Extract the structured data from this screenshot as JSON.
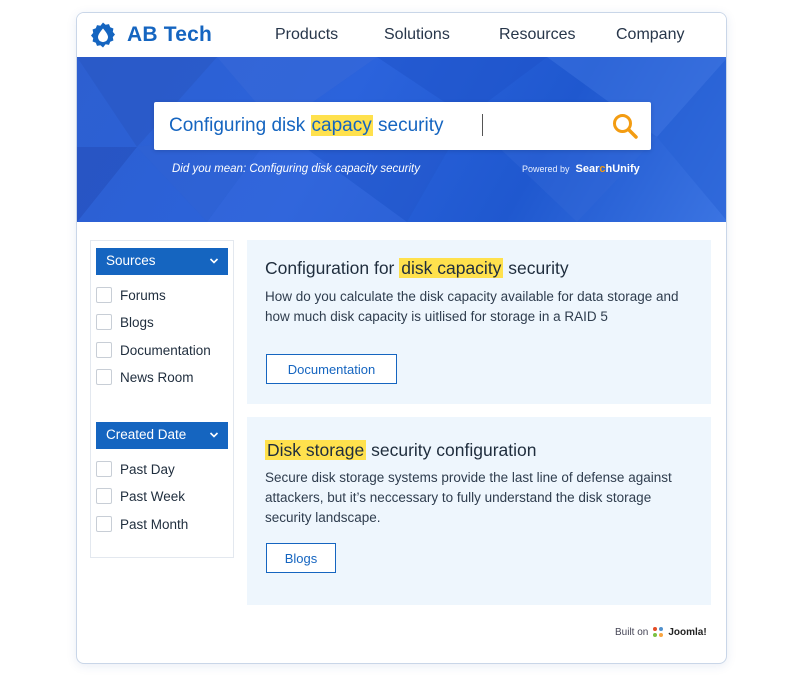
{
  "brand": {
    "name": "AB Tech",
    "logo_icon": "gear-drop-icon"
  },
  "nav": {
    "products": "Products",
    "solutions": "Solutions",
    "resources": "Resources",
    "company": "Company"
  },
  "search": {
    "query_before": "Configuring disk ",
    "query_highlight": "capacy",
    "query_after": " security",
    "did_you_mean": "Did you mean: Configuring disk capacity security",
    "powered_by": "Powered by",
    "powered_brand_pre": "Sear",
    "powered_brand_mid": "c",
    "powered_brand_post": "hUnify",
    "search_icon": "search-icon",
    "accent": "#f39c12"
  },
  "filters": {
    "sources": {
      "label": "Sources",
      "options": [
        "Forums",
        "Blogs",
        "Documentation",
        "News Room"
      ]
    },
    "created_date": {
      "label": "Created Date",
      "options": [
        "Past Day",
        "Past Week",
        "Past Month"
      ]
    }
  },
  "results": [
    {
      "title_before": "Configuration for ",
      "title_highlight": "disk capacity",
      "title_after": " security",
      "description": "How do you calculate the disk capacity available for data storage and how much disk capacity is uitlised for storage in a RAID 5",
      "tag": "Documentation"
    },
    {
      "title_before": "",
      "title_highlight": "Disk storage",
      "title_after": " security configuration",
      "description": "Secure disk storage systems provide the last line of defense against attackers, but it’s neccessary to fully understand the disk storage security landscape.",
      "tag": "Blogs"
    }
  ],
  "footer": {
    "built_on": "Built on",
    "platform": "Joomla!"
  },
  "colors": {
    "primary": "#1565c0",
    "highlight": "#ffe14d",
    "result_bg": "#eef6fd"
  }
}
